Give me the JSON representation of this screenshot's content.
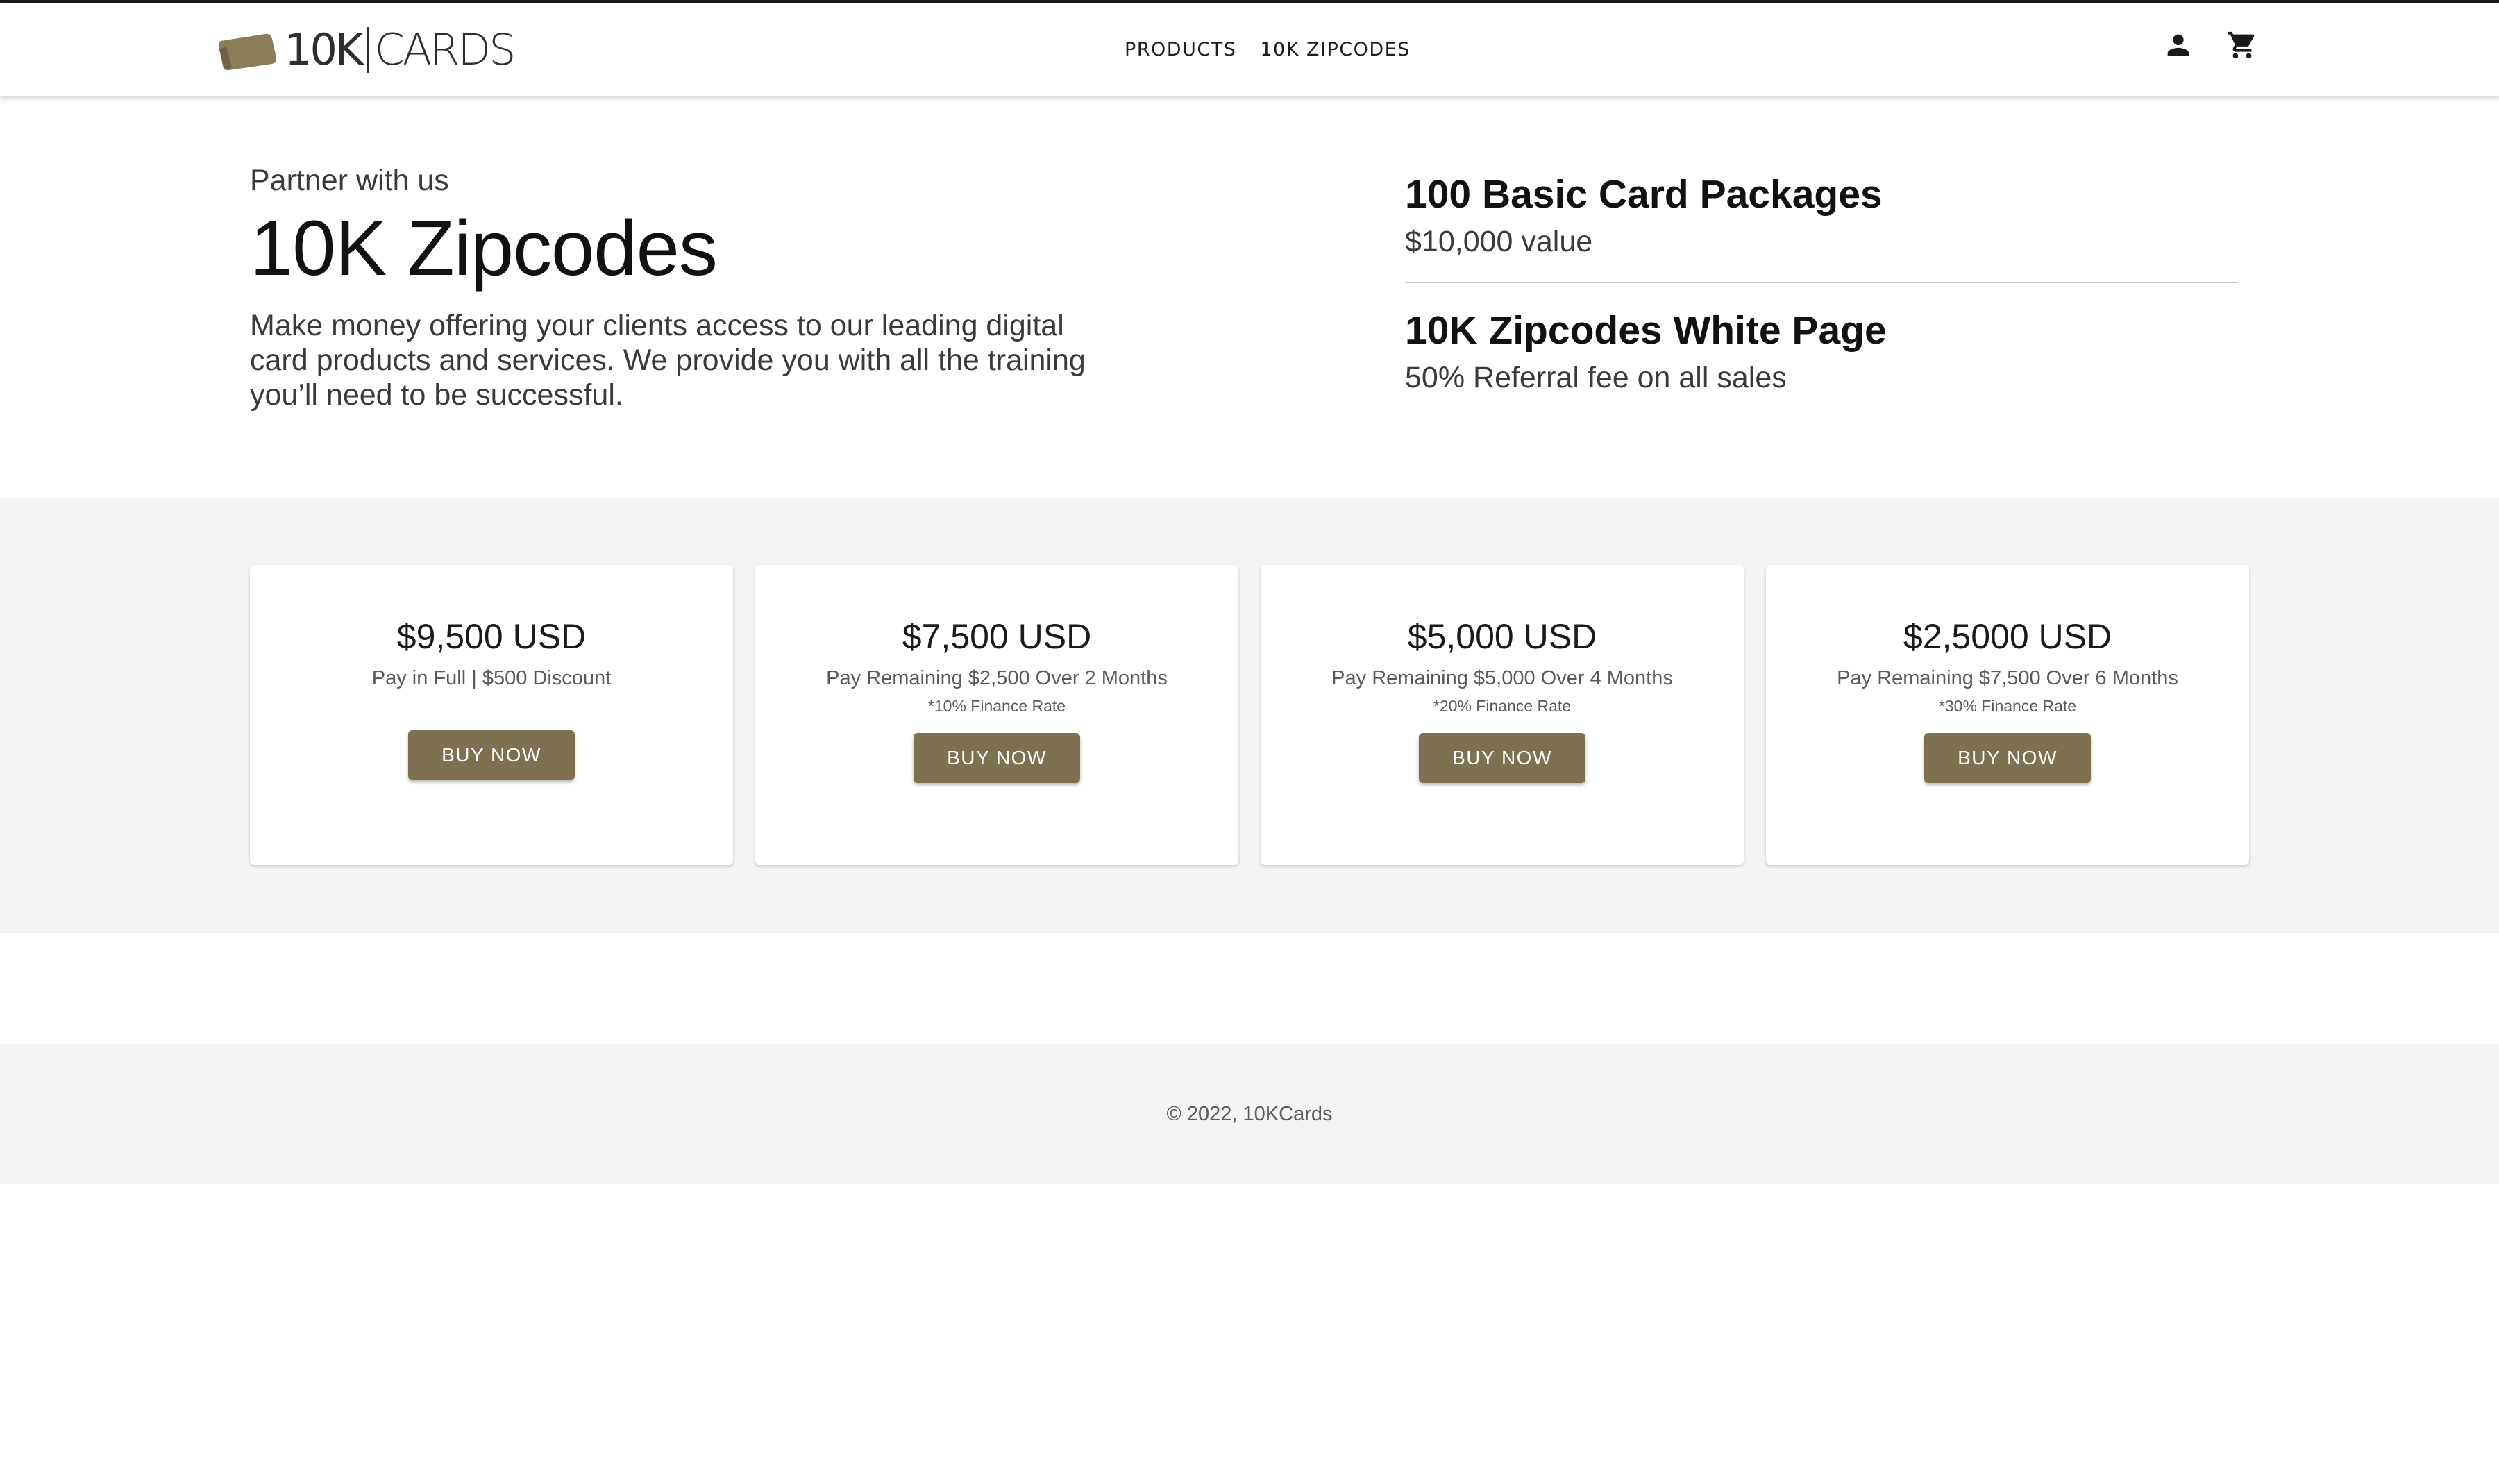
{
  "header": {
    "logo": {
      "prefix": "10K",
      "suffix": "CARDS"
    },
    "nav": [
      {
        "label": "PRODUCTS"
      },
      {
        "label": "10K ZIPCODES"
      }
    ],
    "icons": [
      "account-icon",
      "cart-icon"
    ]
  },
  "hero": {
    "eyebrow": "Partner with us",
    "title": "10K Zipcodes",
    "description": "Make money offering your clients access to our leading digital card products and services. We provide you with all the training you’ll need to be successful.",
    "offers": [
      {
        "title": "100 Basic Card Packages",
        "subtitle": "$10,000 value"
      },
      {
        "title": "10K Zipcodes White Page",
        "subtitle": "50% Referral fee on all sales"
      }
    ]
  },
  "pricing": {
    "plans": [
      {
        "price": "$9,500 USD",
        "terms": "Pay in Full | $500 Discount",
        "rate": "",
        "button": "BUY NOW"
      },
      {
        "price": "$7,500 USD",
        "terms": "Pay Remaining $2,500 Over 2 Months",
        "rate": "*10% Finance Rate",
        "button": "BUY NOW"
      },
      {
        "price": "$5,000 USD",
        "terms": "Pay Remaining $5,000 Over 4 Months",
        "rate": "*20% Finance Rate",
        "button": "BUY NOW"
      },
      {
        "price": "$2,5000 USD",
        "terms": "Pay Remaining $7,500 Over 6 Months",
        "rate": "*30% Finance Rate",
        "button": "BUY NOW"
      }
    ]
  },
  "footer": {
    "copyright": "© 2022, 10KCards"
  },
  "colors": {
    "brand": "#7d7150",
    "band": "#f4f4f4",
    "text": "#1a1a1a"
  }
}
